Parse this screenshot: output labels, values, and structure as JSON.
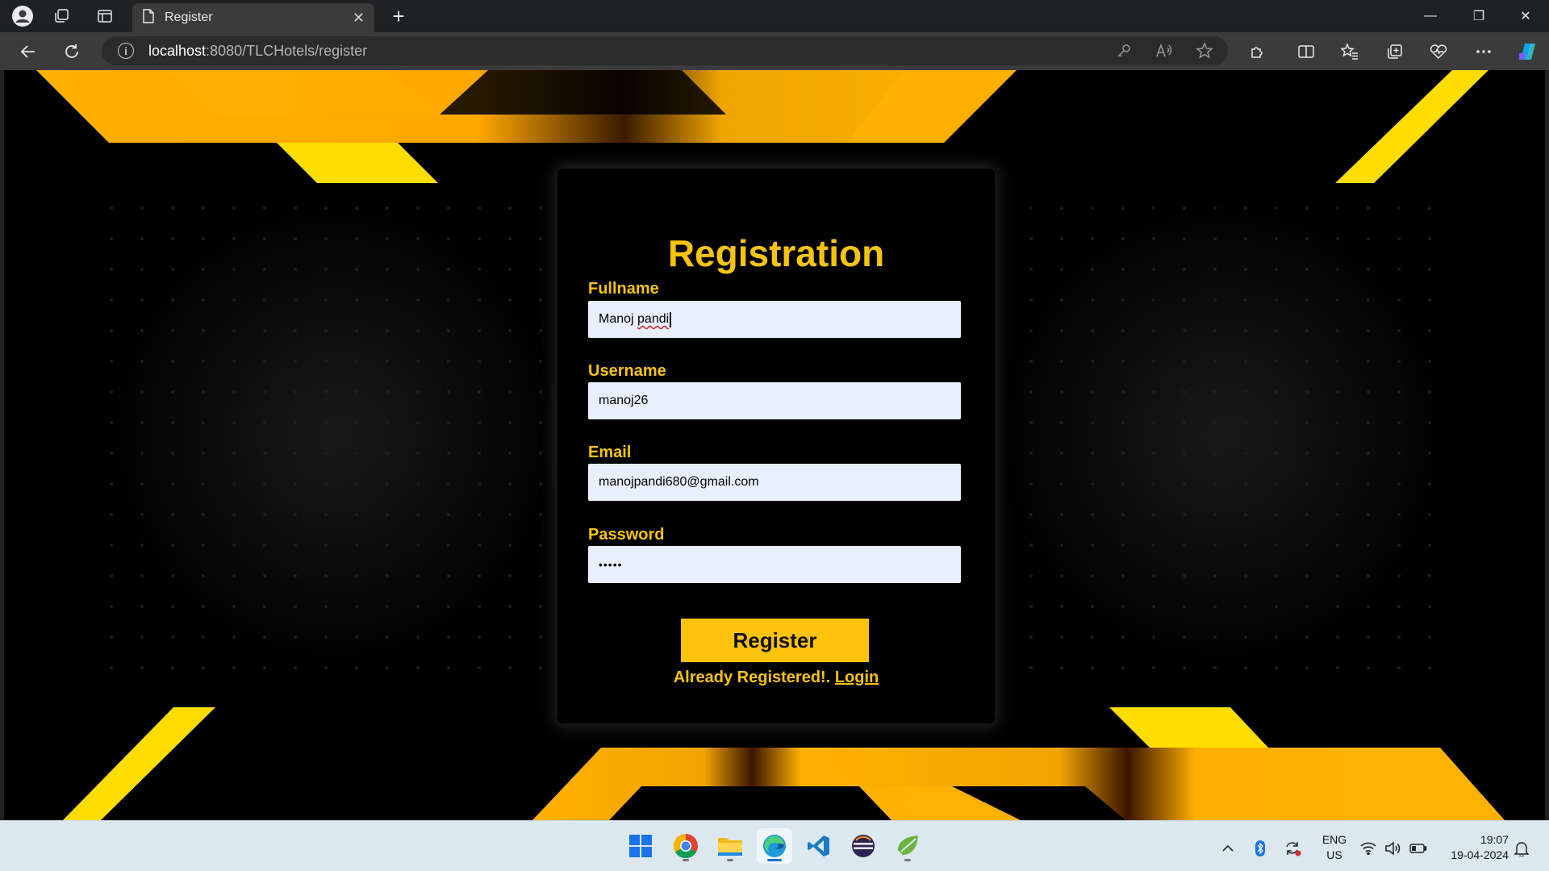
{
  "browser": {
    "tab_title": "Register",
    "tab_close": "✕",
    "new_tab": "+",
    "address_host": "localhost",
    "address_path": ":8080/TLCHotels/register",
    "window_controls": [
      "—",
      "❐",
      "✕"
    ]
  },
  "page": {
    "title": "Registration",
    "fields": [
      {
        "label": "Fullname",
        "value": "Manoj pandi",
        "type": "text"
      },
      {
        "label": "Username",
        "value": "manoj26",
        "type": "text"
      },
      {
        "label": "Email",
        "value": "manojpandi680@gmail.com",
        "type": "email"
      },
      {
        "label": "Password",
        "value": "•••••",
        "type": "password"
      }
    ],
    "register_button": "Register",
    "already_text": "Already Registered!. ",
    "login_link": "Login",
    "colors": {
      "accent": "#f6c40c",
      "button": "#fcc30c",
      "input_bg": "#e8f0fe",
      "background": "#000000"
    }
  },
  "taskbar": {
    "apps": [
      "windows-start-icon",
      "chrome-icon",
      "file-explorer-icon",
      "edge-icon",
      "vscode-icon",
      "eclipse-icon",
      "spring-tools-icon"
    ],
    "lang_line1": "ENG",
    "lang_line2": "US",
    "time": "19:07",
    "date": "19-04-2024"
  }
}
